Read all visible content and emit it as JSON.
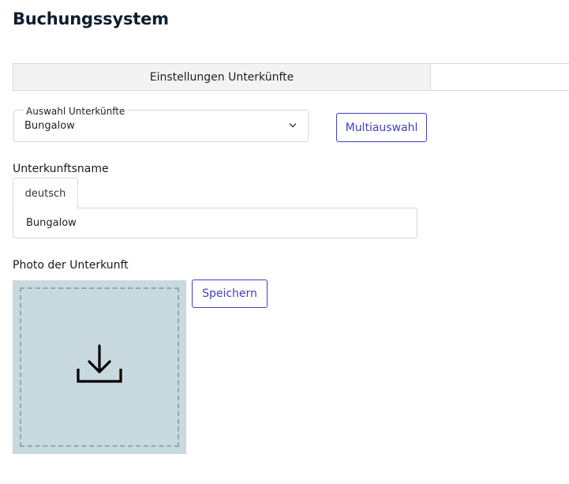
{
  "header": {
    "title": "Buchungssystem"
  },
  "tabs": [
    {
      "label": "Einstellungen Unterkünfte",
      "active": true
    }
  ],
  "accommodation_select": {
    "legend": "Auswahl Unterkünfte",
    "value": "Bungalow",
    "icon": "chevron-down-icon"
  },
  "multiselect_button": {
    "label": "Multiauswahl"
  },
  "name_field": {
    "label": "Unterkunftsname",
    "language_tab": "deutsch",
    "value": "Bungalow"
  },
  "photo": {
    "label": "Photo der Unterkunft",
    "icon": "download-icon",
    "save_label": "Speichern"
  },
  "colors": {
    "accent": "#3f3fc7",
    "dropzone_bg": "#c8d9df",
    "title": "#0f1e2e"
  }
}
